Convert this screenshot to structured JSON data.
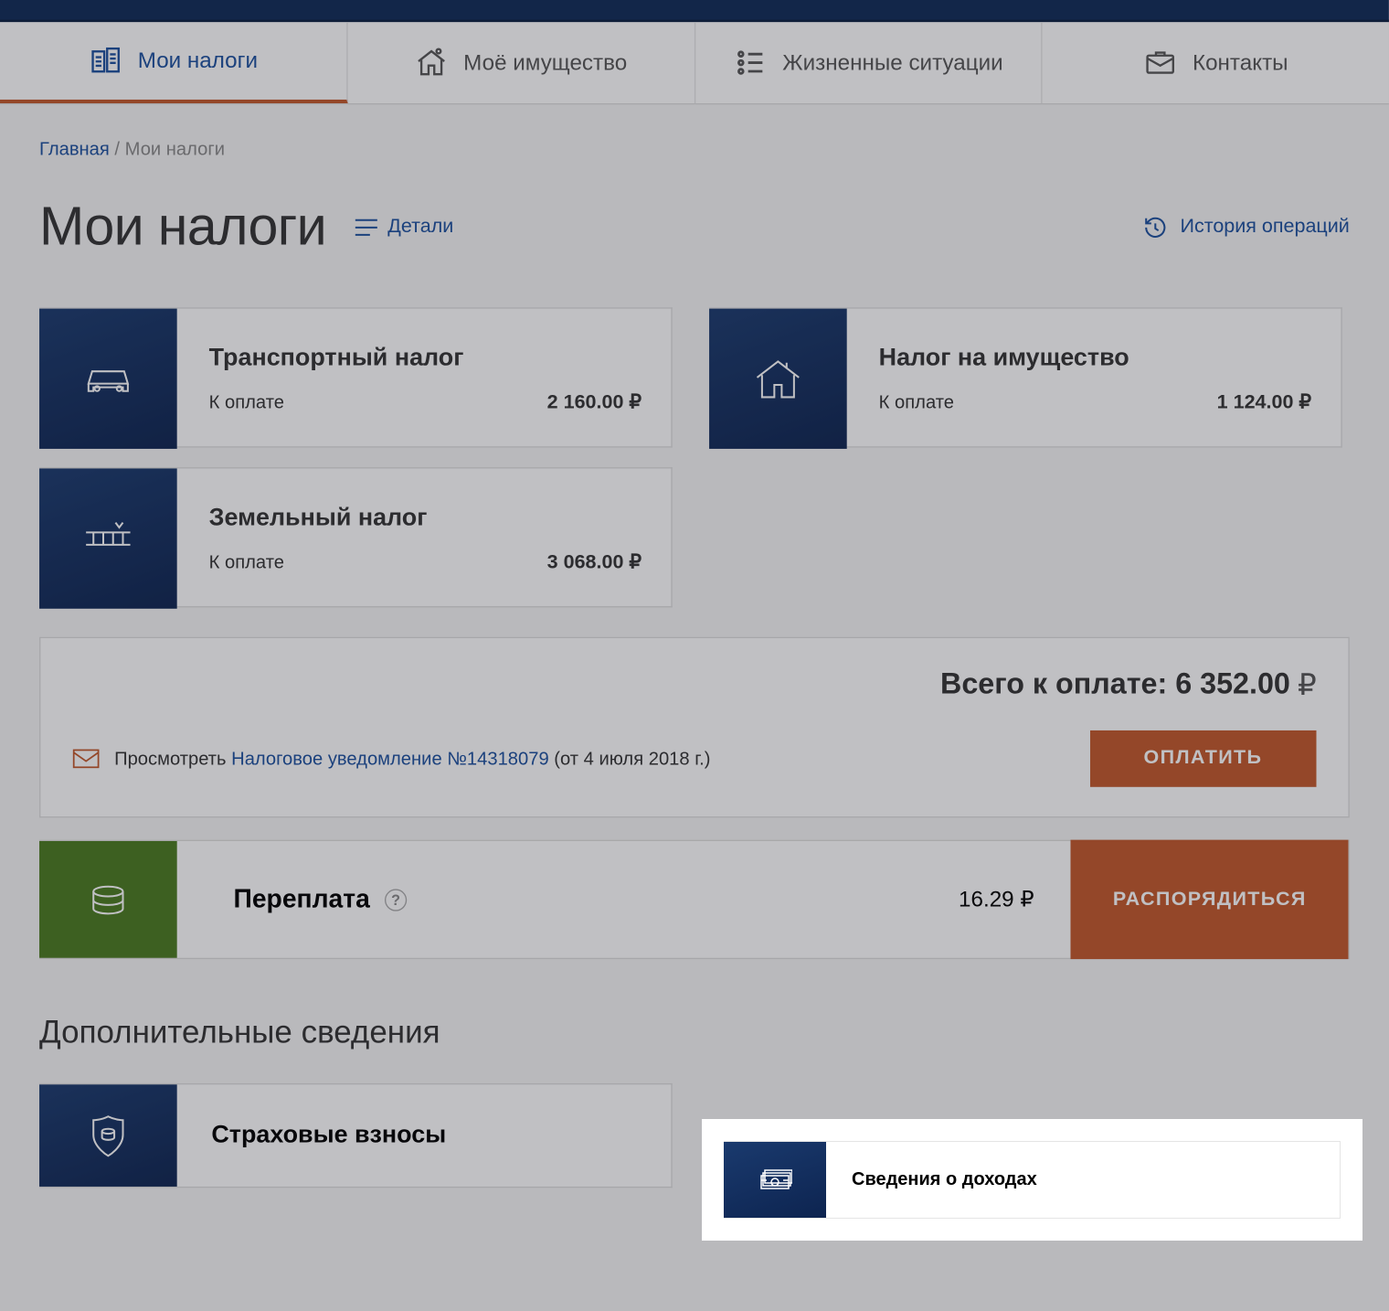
{
  "tabs": [
    {
      "label": "Мои налоги"
    },
    {
      "label": "Моё имущество"
    },
    {
      "label": "Жизненные ситуации"
    },
    {
      "label": "Контакты"
    }
  ],
  "breadcrumb": {
    "home": "Главная",
    "sep": " / ",
    "current": "Мои налоги"
  },
  "page_title": "Мои налоги",
  "details_label": "Детали",
  "history_label": "История операций",
  "taxes": [
    {
      "title": "Транспортный налог",
      "pay_label": "К оплате",
      "amount": "2 160.00 ₽"
    },
    {
      "title": "Налог на имущество",
      "pay_label": "К оплате",
      "amount": "1 124.00 ₽"
    },
    {
      "title": "Земельный налог",
      "pay_label": "К оплате",
      "amount": "3 068.00 ₽"
    }
  ],
  "total": {
    "label": "Всего к оплате:",
    "amount": "6 352.00",
    "ruble": "₽"
  },
  "notice": {
    "prefix": "Просмотреть ",
    "link": "Налоговое уведомление №14318079",
    "suffix": " (от 4 июля 2018 г.)"
  },
  "pay_button": "ОПЛАТИТЬ",
  "overpay": {
    "title": "Переплата",
    "amount": "16.29 ₽",
    "button": "РАСПОРЯДИТЬСЯ"
  },
  "section_title": "Дополнительные сведения",
  "info_cards": [
    {
      "title": "Страховые взносы"
    },
    {
      "title": "Сведения о доходах"
    }
  ]
}
